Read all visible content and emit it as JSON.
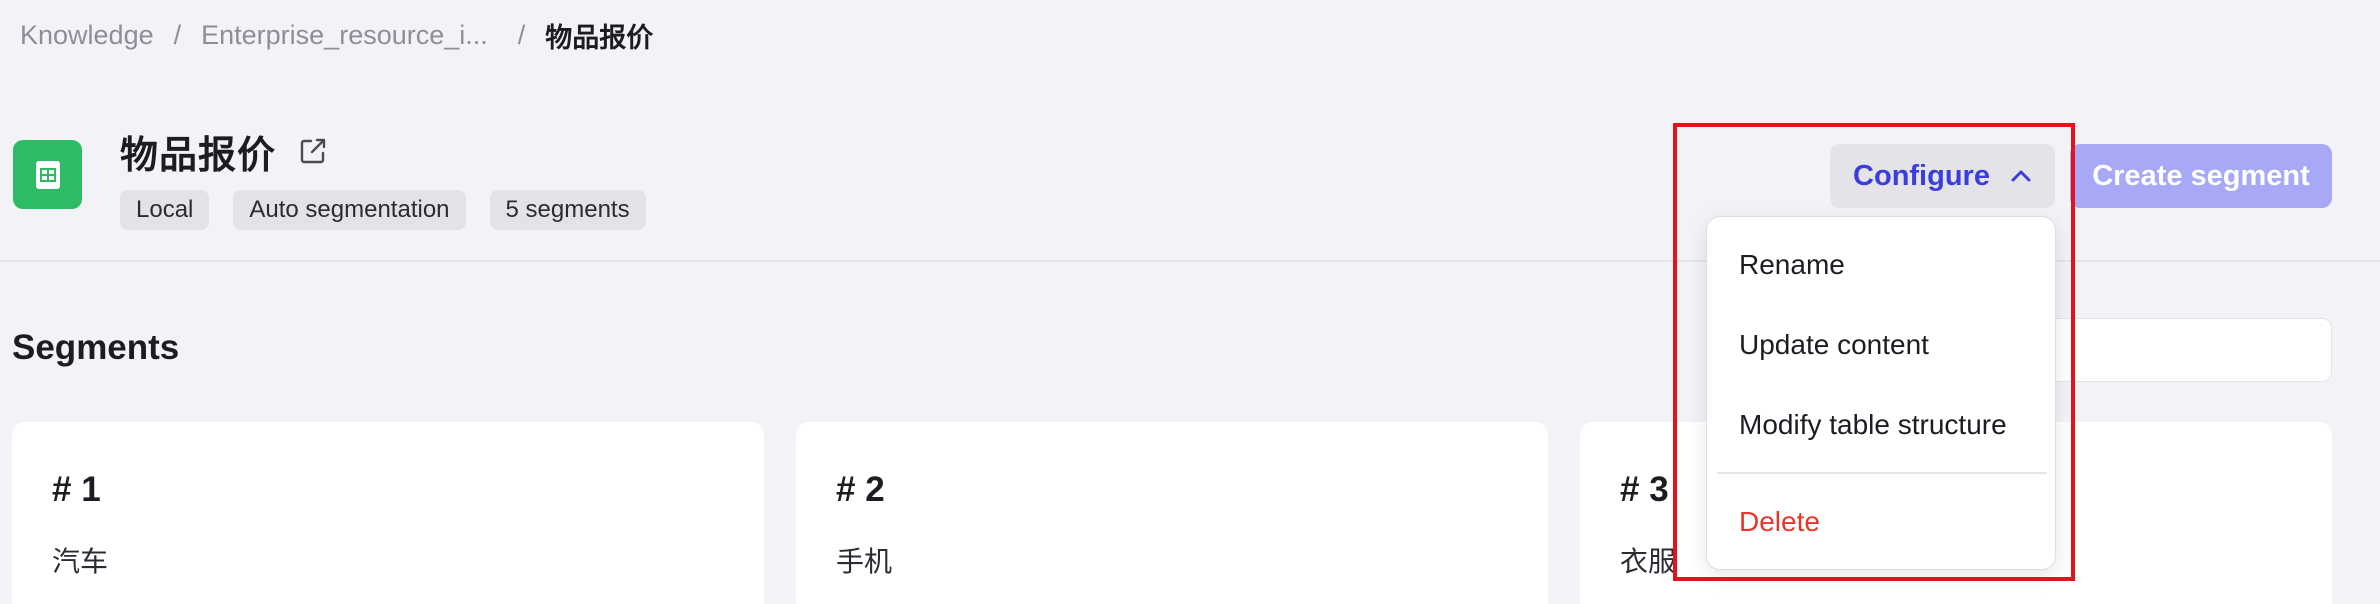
{
  "breadcrumb": {
    "items": [
      "Knowledge",
      "Enterprise_resource_i...",
      "物品报价"
    ],
    "separator": "/"
  },
  "document": {
    "title": "物品报价",
    "icon": "spreadsheet-icon",
    "icon_color": "#2dbb63",
    "tags": [
      "Local",
      "Auto segmentation",
      "5 segments"
    ]
  },
  "toolbar": {
    "configure_label": "Configure",
    "create_label": "Create segment"
  },
  "configure_menu": {
    "items": [
      "Rename",
      "Update content",
      "Modify table structure"
    ],
    "danger_item": "Delete"
  },
  "segments": {
    "title": "Segments",
    "cards": [
      {
        "number": "# 1",
        "text": "汽车"
      },
      {
        "number": "# 2",
        "text": "手机"
      },
      {
        "number": "# 3",
        "text": "衣服"
      }
    ]
  },
  "colors": {
    "accent": "#3b3edb",
    "accent_disabled": "#a7a9f6",
    "danger": "#e8362a",
    "highlight": "#e5111b"
  }
}
